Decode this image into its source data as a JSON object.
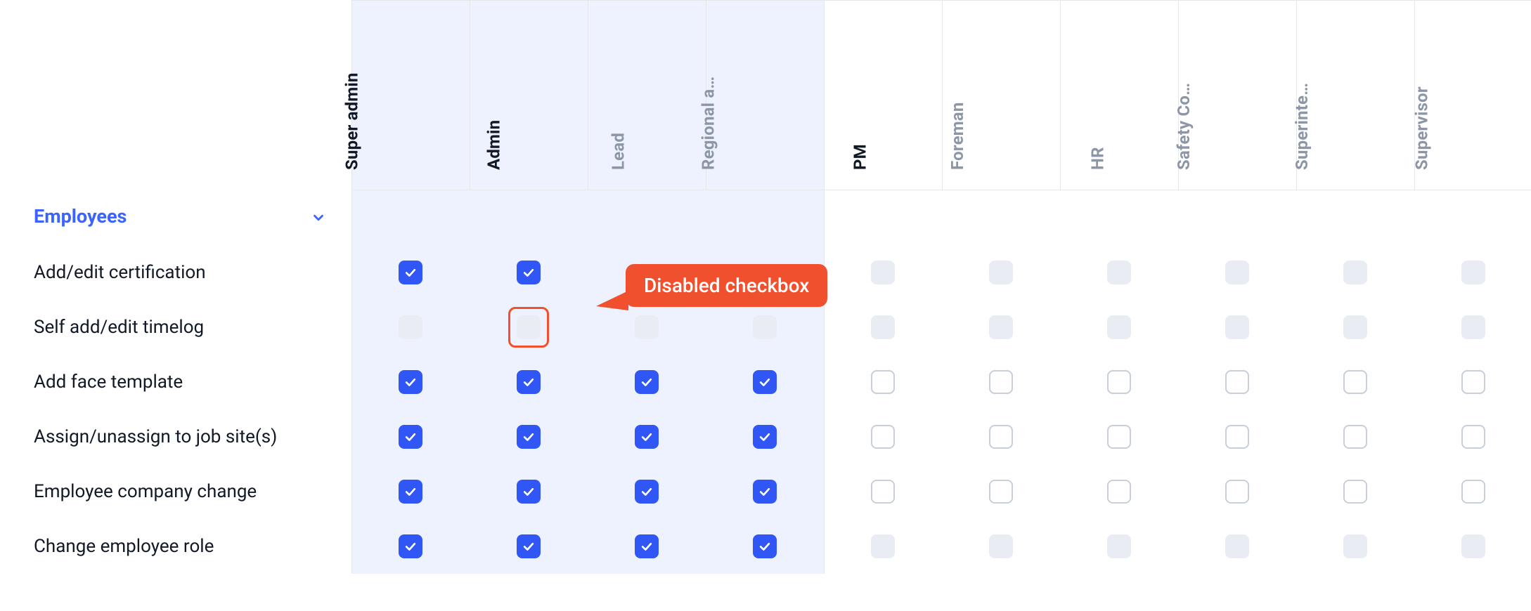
{
  "colors": {
    "accent_blue": "#3056f5",
    "tint_bg": "#edf2fe",
    "border": "#e5e7eb",
    "muted_text": "#8d96a7",
    "annotation": "#f0502d"
  },
  "annotation": {
    "label": "Disabled checkbox",
    "target_row_index": 1,
    "target_role_index": 1
  },
  "roles": [
    {
      "id": "super-admin",
      "label": "Super admin",
      "tinted": true,
      "muted": false
    },
    {
      "id": "admin",
      "label": "Admin",
      "tinted": true,
      "muted": false
    },
    {
      "id": "lead",
      "label": "Lead",
      "tinted": true,
      "muted": true
    },
    {
      "id": "regional-a",
      "label": "Regional a…",
      "tinted": true,
      "muted": true
    },
    {
      "id": "pm",
      "label": "PM",
      "tinted": false,
      "muted": false
    },
    {
      "id": "foreman",
      "label": "Foreman",
      "tinted": false,
      "muted": true
    },
    {
      "id": "hr",
      "label": "HR",
      "tinted": false,
      "muted": true
    },
    {
      "id": "safety-co",
      "label": "Safety Co…",
      "tinted": false,
      "muted": true
    },
    {
      "id": "superinte",
      "label": "Superinte…",
      "tinted": false,
      "muted": true
    },
    {
      "id": "supervisor",
      "label": "Supervisor",
      "tinted": false,
      "muted": true
    }
  ],
  "group": {
    "label": "Employees",
    "expanded": true
  },
  "permissions": [
    {
      "id": "add-edit-cert",
      "label": "Add/edit certification",
      "cells": [
        "checked",
        "checked",
        "",
        "",
        "disabled",
        "disabled",
        "disabled",
        "disabled",
        "disabled",
        "disabled"
      ]
    },
    {
      "id": "self-timelog",
      "label": "Self add/edit timelog",
      "cells": [
        "disabled",
        "disabled",
        "disabled",
        "disabled",
        "disabled",
        "disabled",
        "disabled",
        "disabled",
        "disabled",
        "disabled"
      ]
    },
    {
      "id": "add-face-template",
      "label": "Add face template",
      "cells": [
        "checked",
        "checked",
        "checked",
        "checked",
        "unchecked",
        "unchecked",
        "unchecked",
        "unchecked",
        "unchecked",
        "unchecked"
      ]
    },
    {
      "id": "assign-jobsite",
      "label": "Assign/unassign to job site(s)",
      "cells": [
        "checked",
        "checked",
        "checked",
        "checked",
        "unchecked",
        "unchecked",
        "unchecked",
        "unchecked",
        "unchecked",
        "unchecked"
      ]
    },
    {
      "id": "company-change",
      "label": "Employee company change",
      "cells": [
        "checked",
        "checked",
        "checked",
        "checked",
        "unchecked",
        "unchecked",
        "unchecked",
        "unchecked",
        "unchecked",
        "unchecked"
      ]
    },
    {
      "id": "change-role",
      "label": "Change employee role",
      "cells": [
        "checked",
        "checked",
        "checked",
        "checked",
        "disabled",
        "disabled",
        "disabled",
        "disabled",
        "disabled",
        "disabled"
      ]
    }
  ]
}
